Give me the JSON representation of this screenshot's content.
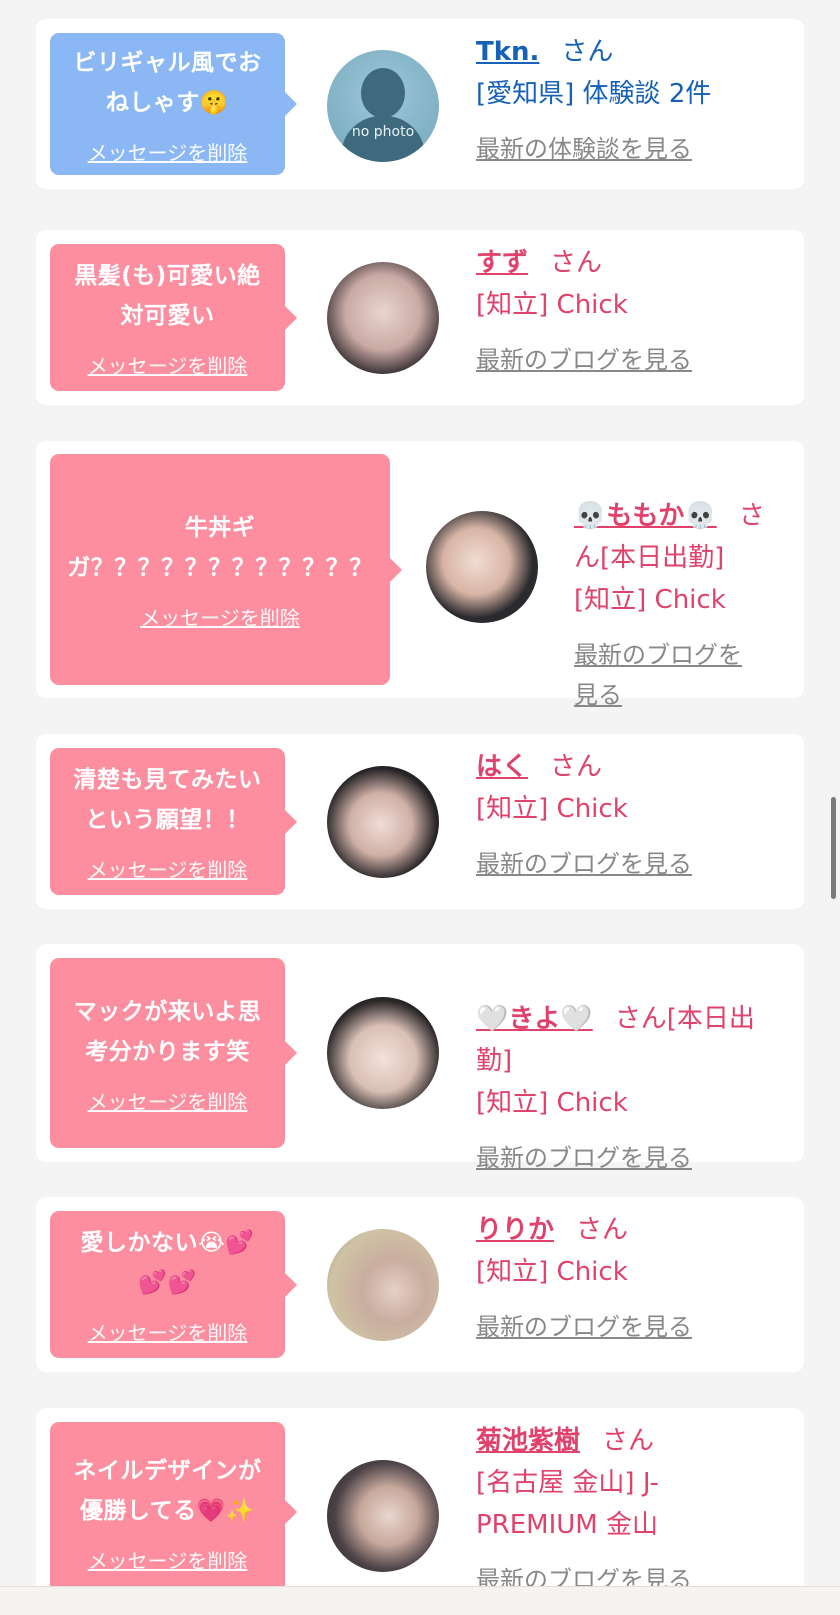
{
  "items": [
    {
      "message": "ビリギャル風でお\nねしゃす🤫",
      "delete_label": "メッセージを削除",
      "name": "Tkn.",
      "san": "さん",
      "line2": "[愛知県] 体験談 2件",
      "line3": "",
      "link": "最新の体験談を見る",
      "theme": "blue",
      "avatar_label": "no photo"
    },
    {
      "message": "黒髪(も)可愛い絶\n対可愛い",
      "delete_label": "メッセージを削除",
      "name": "すず",
      "san": "さん",
      "line2": "[知立] Chick",
      "line3": "",
      "link": "最新のブログを見る",
      "theme": "pink"
    },
    {
      "message": "牛丼ギ\nガ？？？？？？？？？？？？",
      "delete_label": "メッセージを削除",
      "name": "💀ももか💀",
      "san": "さ\nん[本日出勤]",
      "line2": "[知立] Chick",
      "line3": "",
      "link": "最新のブログを\n見る",
      "theme": "pink"
    },
    {
      "message": "清楚も見てみたい\nという願望！！",
      "delete_label": "メッセージを削除",
      "name": "はく",
      "san": "さん",
      "line2": "[知立] Chick",
      "line3": "",
      "link": "最新のブログを見る",
      "theme": "pink"
    },
    {
      "message": "マックが来いよ思\n考分かります笑",
      "delete_label": "メッセージを削除",
      "name": "🤍きよ🤍",
      "san": "さん[本日出\n勤]",
      "line2": "[知立] Chick",
      "line3": "",
      "link": "最新のブログを見る",
      "theme": "pink"
    },
    {
      "message": "愛しかない😭💕\n💕💕",
      "delete_label": "メッセージを削除",
      "name": "りりか",
      "san": "さん",
      "line2": "[知立] Chick",
      "line3": "",
      "link": "最新のブログを見る",
      "theme": "pink"
    },
    {
      "message": "ネイルデザインが\n優勝してる💗✨",
      "delete_label": "メッセージを削除",
      "name": "菊池紫樹",
      "san": "さん",
      "line2": "[名古屋 金山] J-\nPREMIUM 金山",
      "line3": "",
      "link": "最新のブログを見る",
      "theme": "pink"
    }
  ],
  "colors": {
    "blue_bubble": "#8bb8f5",
    "pink_bubble": "#fc8ea0",
    "blue_text": "#1561b8",
    "pink_text": "#e0426b",
    "link_gray": "#888888"
  }
}
